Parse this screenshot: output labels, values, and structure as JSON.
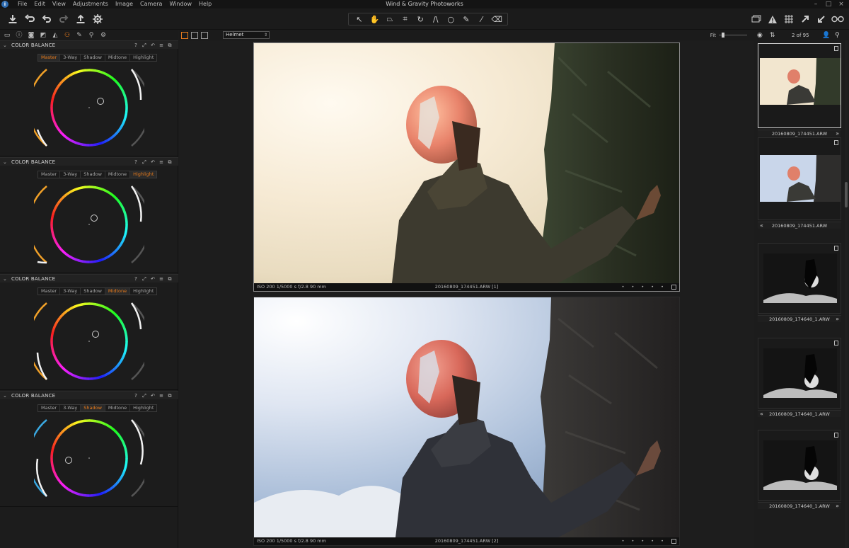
{
  "app": {
    "title": "Wind & Gravity Photoworks",
    "menu": [
      "File",
      "Edit",
      "View",
      "Adjustments",
      "Image",
      "Camera",
      "Window",
      "Help"
    ]
  },
  "toolbar": {
    "left_icons": [
      "import-icon",
      "undo-all-icon",
      "undo-icon",
      "redo-icon",
      "export-icon",
      "settings-icon"
    ],
    "cursor_tools": [
      "select-icon",
      "hand-icon",
      "perspective-icon",
      "crop-icon",
      "rotate-icon",
      "keystone-icon",
      "circle-icon",
      "brush-icon",
      "picker-icon",
      "eraser-icon"
    ],
    "active_tool": "hand-icon",
    "right_icons": [
      "copy-icon",
      "warning-icon",
      "grid-icon",
      "expand-icon",
      "apply-icon",
      "proof-glasses-icon"
    ]
  },
  "tool_tabs": [
    "library-icon",
    "info-icon",
    "camera-icon",
    "exposure-icon",
    "lens-icon",
    "color-icon",
    "brush-tab-icon",
    "search-tab-icon",
    "gear-tab-icon"
  ],
  "color_balance": [
    {
      "title": "COLOR BALANCE",
      "tabs": [
        "Master",
        "3-Way",
        "Shadow",
        "Midtone",
        "Highlight"
      ],
      "active_tab": "Master"
    },
    {
      "title": "COLOR BALANCE",
      "tabs": [
        "Master",
        "3-Way",
        "Shadow",
        "Midtone",
        "Highlight"
      ],
      "active_tab": "Highlight"
    },
    {
      "title": "COLOR BALANCE",
      "tabs": [
        "Master",
        "3-Way",
        "Shadow",
        "Midtone",
        "Highlight"
      ],
      "active_tab": "Midtone"
    },
    {
      "title": "COLOR BALANCE",
      "tabs": [
        "Master",
        "3-Way",
        "Shadow",
        "Midtone",
        "Highlight"
      ],
      "active_tab": "Shadow"
    }
  ],
  "viewer": {
    "preset": "Helmet",
    "fit_label": "Fit",
    "images": [
      {
        "exif": "ISO 200  1/5000 s  f/2.8  90 mm",
        "filename": "20160809_174451.ARW [1]",
        "rating": "• • • • •"
      },
      {
        "exif": "ISO 200  1/5000 s  f/2.8  90 mm",
        "filename": "20160809_174451.ARW [2]",
        "rating": "• • • • •"
      }
    ]
  },
  "browser": {
    "count": "2 of 95",
    "thumbs": [
      {
        "label": "20160809_174451.ARW",
        "selected": true
      },
      {
        "label": "20160809_174451.ARW",
        "selected": false
      },
      {
        "label": "20160809_174640_1.ARW",
        "selected": false
      },
      {
        "label": "20160809_174640_1.ARW",
        "selected": false
      },
      {
        "label": "20160809_174640_1.ARW",
        "selected": false
      }
    ]
  },
  "colors": {
    "accent": "#e87b1c",
    "panel": "#1c1c1c"
  }
}
